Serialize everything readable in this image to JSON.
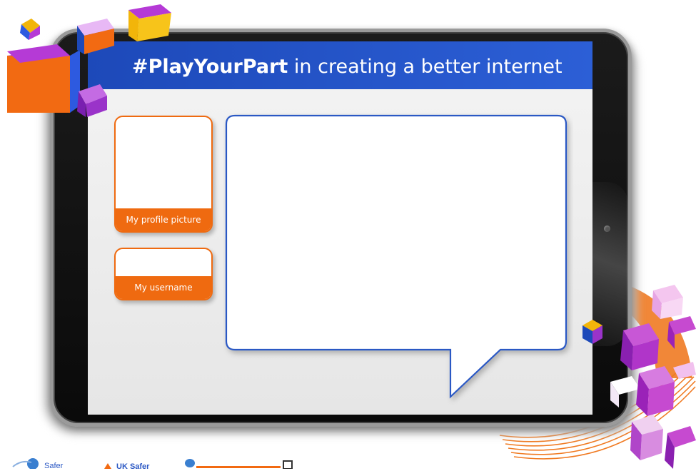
{
  "header": {
    "hashtag": "#PlayYourPart",
    "rest": " in creating a better internet"
  },
  "cards": {
    "profile_picture_label": "My profile picture",
    "username_label": "My username"
  },
  "footer": {
    "logo_1_text": "Safer",
    "logo_2_text": "UK Safer"
  },
  "colors": {
    "header_blue": "#1d49b9",
    "accent_orange": "#ef6a10",
    "bubble_border": "#2b58c4",
    "cube_purple": "#8e2bb8",
    "cube_orange": "#f06a12"
  },
  "icons": {
    "decor_top_left": "cube-cluster-icon",
    "decor_bottom_right": "cube-cluster-icon",
    "speech_bubble": "speech-bubble-icon"
  }
}
